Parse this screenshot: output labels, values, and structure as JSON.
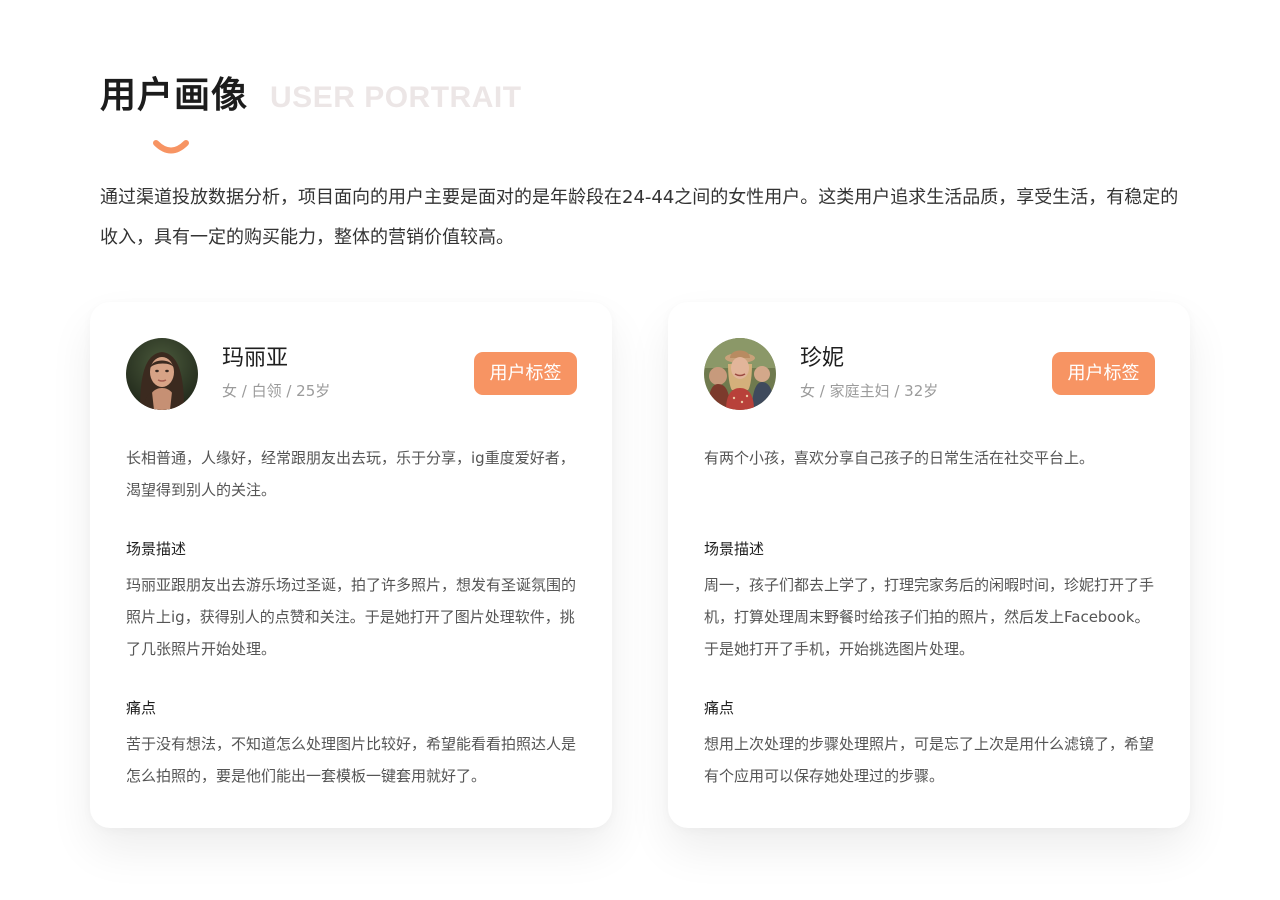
{
  "header": {
    "title": "用户画像",
    "subtitle": "USER PORTRAIT"
  },
  "intro": "通过渠道投放数据分析，项目面向的用户主要是面对的是年龄段在24-44之间的女性用户。这类用户追求生活品质，享受生活，有稳定的收入，具有一定的购买能力，整体的营销价值较高。",
  "colors": {
    "accent": "#f79463",
    "subtitle": "#ece6e6"
  },
  "personas": [
    {
      "name": "玛丽亚",
      "meta": "女 / 白领 / 25岁",
      "tag_label": "用户标签",
      "description": "长相普通，人缘好，经常跟朋友出去玩，乐于分享，ig重度爱好者，渴望得到别人的关注。",
      "scene_title": "场景描述",
      "scene": "玛丽亚跟朋友出去游乐场过圣诞，拍了许多照片，想发有圣诞氛围的照片上ig，获得别人的点赞和关注。于是她打开了图片处理软件，挑了几张照片开始处理。",
      "pain_title": "痛点",
      "pain": "苦于没有想法，不知道怎么处理图片比较好，希望能看看拍照达人是怎么拍照的，要是他们能出一套模板一键套用就好了。"
    },
    {
      "name": "珍妮",
      "meta": "女 / 家庭主妇 / 32岁",
      "tag_label": "用户标签",
      "description": "有两个小孩，喜欢分享自己孩子的日常生活在社交平台上。",
      "scene_title": "场景描述",
      "scene": "周一，孩子们都去上学了，打理完家务后的闲暇时间，珍妮打开了手机，打算处理周末野餐时给孩子们拍的照片，然后发上Facebook。于是她打开了手机，开始挑选图片处理。",
      "pain_title": "痛点",
      "pain": "想用上次处理的步骤处理照片，可是忘了上次是用什么滤镜了，希望有个应用可以保存她处理过的步骤。"
    }
  ]
}
